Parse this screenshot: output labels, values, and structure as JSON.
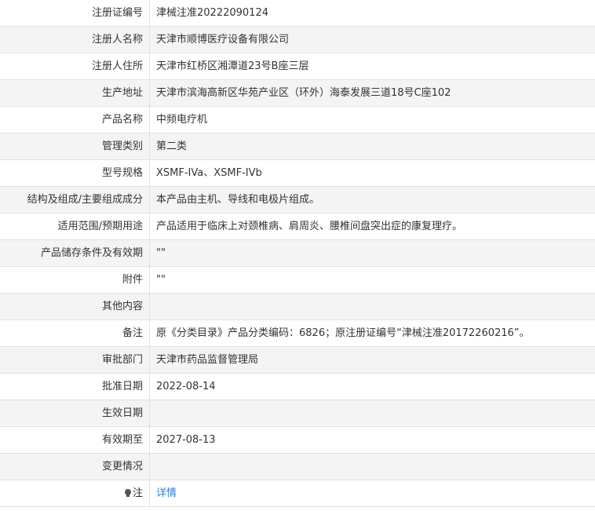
{
  "rows": [
    {
      "label": "注册证编号",
      "value": "津械注准20222090124"
    },
    {
      "label": "注册人名称",
      "value": "天津市顺博医疗设备有限公司"
    },
    {
      "label": "注册人住所",
      "value": "天津市红桥区湘潭道23号B座三层"
    },
    {
      "label": "生产地址",
      "value": "天津市滨海高新区华苑产业区（环外）海泰发展三道18号C座102"
    },
    {
      "label": "产品名称",
      "value": "中频电疗机"
    },
    {
      "label": "管理类别",
      "value": "第二类"
    },
    {
      "label": "型号规格",
      "value": "XSMF-IVa、XSMF-IVb"
    },
    {
      "label": "结构及组成/主要组成成分",
      "value": "本产品由主机、导线和电极片组成。"
    },
    {
      "label": "适用范围/预期用途",
      "value": "产品适用于临床上对颈椎病、肩周炎、腰椎间盘突出症的康复理疗。"
    },
    {
      "label": "产品储存条件及有效期",
      "value": "\"\""
    },
    {
      "label": "附件",
      "value": "\"\""
    },
    {
      "label": "其他内容",
      "value": ""
    },
    {
      "label": "备注",
      "value": "原《分类目录》产品分类编码：6826；原注册证编号“津械注准20172260216”。"
    },
    {
      "label": "审批部门",
      "value": "天津市药品监督管理局"
    },
    {
      "label": "批准日期",
      "value": "2022-08-14"
    },
    {
      "label": "生效日期",
      "value": ""
    },
    {
      "label": "有效期至",
      "value": "2027-08-13"
    },
    {
      "label": "变更情况",
      "value": ""
    }
  ],
  "note": {
    "label": "注",
    "icon": "lightbulb-icon",
    "link_text": "详情",
    "link_color": "#2b7fd4"
  }
}
